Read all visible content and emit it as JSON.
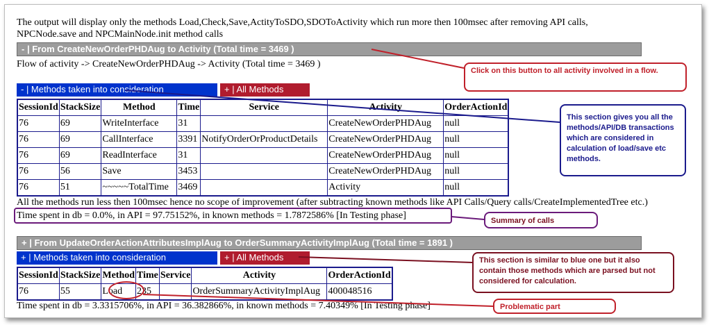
{
  "intro_text": "The output will display only the methods Load,Check,Save,ActityToSDO,SDOToActivity which run more then 100msec after removing API calls,",
  "intro_text2": "NPCNode.save and NPCMainNode.init method calls",
  "section1": {
    "header": "- | From CreateNewOrderPHDAug  to Activity (Total time = 3469 )",
    "flow_text": "Flow of activity -> CreateNewOrderPHDAug -> Activity (Total time = 3469 )",
    "considered_button": "- | Methods taken into consideration",
    "all_methods_button": "+ | All Methods",
    "columns": [
      "SessionId",
      "StackSize",
      "Method",
      "Time",
      "Service",
      "Activity",
      "OrderActionId"
    ],
    "rows": [
      [
        "76",
        "69",
        "WriteInterface",
        "31",
        "",
        "CreateNewOrderPHDAug",
        "null"
      ],
      [
        "76",
        "69",
        "CallInterface",
        "3391",
        "NotifyOrderOrProductDetails",
        "CreateNewOrderPHDAug",
        "null"
      ],
      [
        "76",
        "69",
        "ReadInterface",
        "31",
        "",
        "CreateNewOrderPHDAug",
        "null"
      ],
      [
        "76",
        "56",
        "Save",
        "3453",
        "",
        "CreateNewOrderPHDAug",
        "null"
      ],
      [
        "76",
        "51",
        "~~~~~TotalTime",
        "3469",
        "",
        "Activity",
        "null"
      ]
    ],
    "note": "All the methods run less then 100msec hence no scope of improvement (after subtracting known methods like API Calls/Query calls/CreateImplementedTree etc.)",
    "summary": "Time spent in db = 0.0%, in API = 97.75152%, in known methods = 1.7872586% [In Testing phase]"
  },
  "section2": {
    "header": "+ | From UpdateOrderActionAttributesImplAug  to OrderSummaryActivityImplAug  (Total time = 1891 )",
    "considered_button": "+ | Methods taken into consideration",
    "all_methods_button": "+ | All Methods",
    "columns": [
      "SessionId",
      "StackSize",
      "Method",
      "Time",
      "Service",
      "Activity",
      "OrderActionId"
    ],
    "rows": [
      [
        "76",
        "55",
        "Load",
        "235",
        "",
        "OrderSummaryActivityImplAug",
        "400048516"
      ]
    ],
    "summary": "Time spent in db = 3.3315706%, in API = 36.382866%, in known methods = 7.40349% [In Testing phase]"
  },
  "callouts": {
    "activity_button": "Click on this button to all activity involved in a flow.",
    "methods_section": "This section gives you all the methods/API/DB transactions which are considered in calculation of load/save etc methods.",
    "summary": "Summary of calls",
    "red_section": "This section is similar to blue one but it also contain those methods which are parsed but not considered for calculation.",
    "problem": "Problematic part"
  },
  "colors": {
    "callout_red": "#c0202a",
    "callout_navy": "#1a1a8c",
    "callout_purple": "#6a1a7a",
    "callout_maroon": "#7a1020",
    "button_blue": "#0033cc",
    "button_red": "#b01c2e",
    "header_gray": "#9c9c9c"
  }
}
